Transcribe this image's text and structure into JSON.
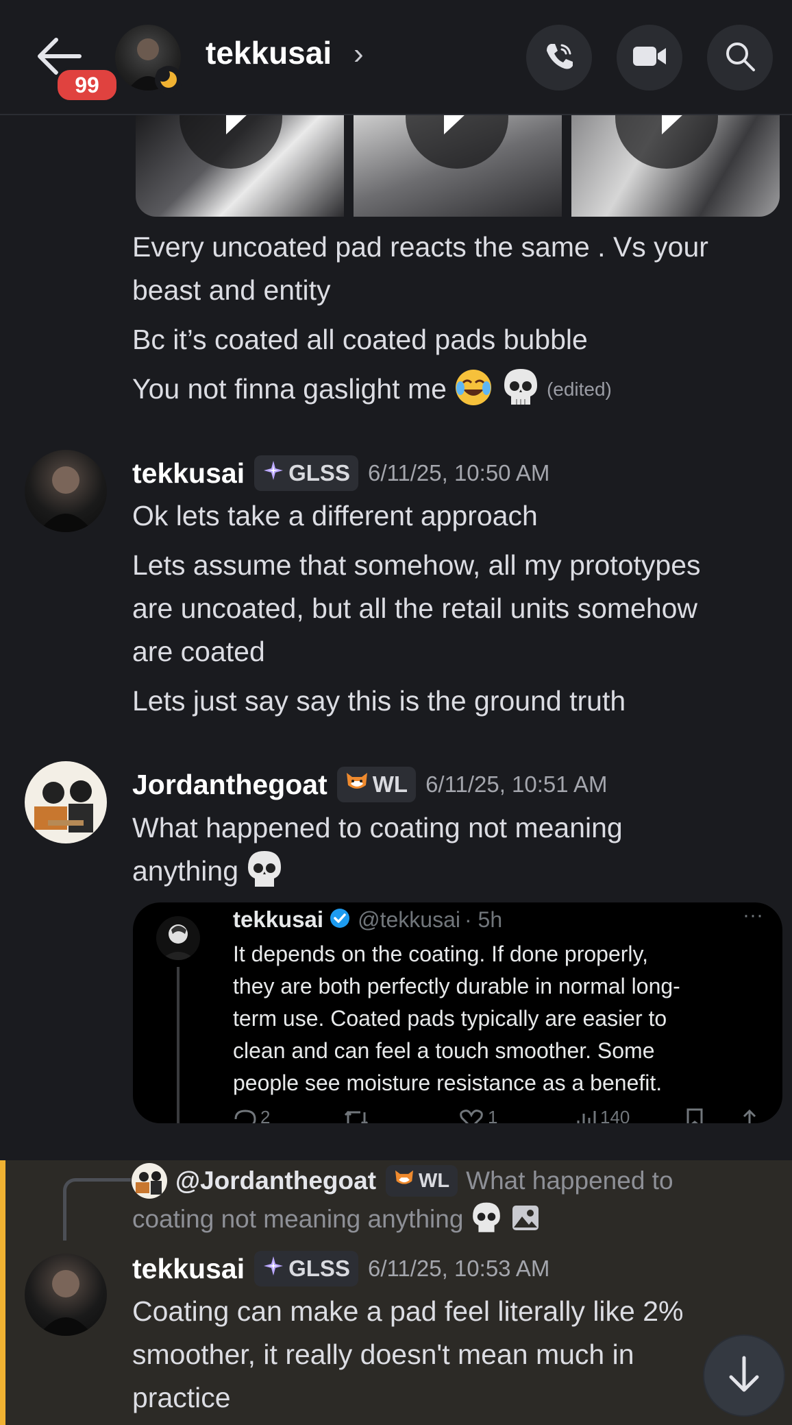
{
  "header": {
    "badge": "99",
    "title": "tekkusai",
    "chevron": "›"
  },
  "messages": {
    "first": {
      "lines": [
        "Every uncoated pad reacts the same  . Vs your",
        "beast and entity",
        "Bc it’s coated all coated pads bubble",
        "You  not finna gaslight me"
      ],
      "edited": "(edited)"
    },
    "second": {
      "author": "tekkusai",
      "tag": "GLSS",
      "time": "6/11/25, 10:50 AM",
      "lines": [
        "Ok lets take a different approach",
        "Lets assume that somehow, all my prototypes",
        "are uncoated, but all the retail units somehow",
        "are coated",
        "Lets just say say this is the ground truth"
      ]
    },
    "third": {
      "author": "Jordanthegoat",
      "tag": "WL",
      "time": "6/11/25, 10:51 AM",
      "lines": [
        "What happened to coating not meaning",
        "anything"
      ]
    },
    "tweet": {
      "name": "tekkusai",
      "handle": "@tekkusai",
      "age": "· 5h",
      "more": "···",
      "lines": [
        "It depends on the coating. If done properly,",
        "they are both perfectly durable in normal long-",
        "term use. Coated pads typically are easier to",
        "clean and can feel a touch smoother. Some",
        "people see moisture resistance as a benefit."
      ],
      "stats": {
        "replies": "2",
        "likes": "1",
        "views": "140"
      }
    },
    "reply": {
      "ref_author": "@Jordanthegoat",
      "ref_tag": "WL",
      "ref_text_1": "What happened to",
      "ref_text_2": "coating not meaning anything",
      "author": "tekkusai",
      "tag": "GLSS",
      "time": "6/11/25, 10:53 AM",
      "lines": [
        "Coating can make a pad feel literally like 2%",
        "smoother, it really doesn't mean much in",
        "practice"
      ]
    }
  },
  "colors": {
    "background": "#1a1b1f",
    "highlight": "#2c2a26",
    "accent_bar": "#f0b232",
    "badge": "#e0423f",
    "verified": "#1d9bf0"
  }
}
